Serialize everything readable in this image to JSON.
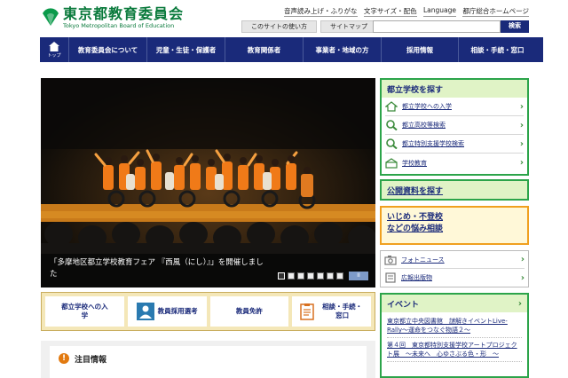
{
  "header": {
    "logo_ja": "東京都教育委員会",
    "logo_en": "Tokyo Metropolitan Board of Education",
    "top_links": [
      "音声読み上げ・ふりがな",
      "文字サイズ・配色",
      "Language",
      "都庁総合ホームページ"
    ],
    "site_usage": "このサイトの使い方",
    "sitemap": "サイトマップ",
    "search_placeholder": "",
    "search_button": "検索"
  },
  "nav": {
    "home_label": "トップ",
    "items": [
      "教育委員会について",
      "児童・生徒・保護者",
      "教育関係者",
      "事業者・地域の方",
      "採用情報",
      "相談・手続・窓口"
    ]
  },
  "hero": {
    "caption": "「多摩地区都立学校教育フェア 『西風（にし）』」を開催しました",
    "pause_label": "II",
    "dot_count": 7,
    "active_dot": 0
  },
  "quick_links": [
    "都立学校への入学",
    "教員採用選考",
    "教員免許",
    "相談・手続・窓口"
  ],
  "notice": {
    "title": "注目情報"
  },
  "right": {
    "school_search": {
      "title": "都立学校を探す",
      "items": [
        "都立学校への入学",
        "都立高校等検索",
        "都立特別支援学校検索",
        "学校教育"
      ]
    },
    "public_docs": "公開資料を探す",
    "bullying": [
      "いじめ・不登校",
      "などの悩み相談"
    ],
    "media": [
      "フォトニュース",
      "広報出版物"
    ],
    "events": {
      "title": "イベント",
      "items": [
        "東京都立中央図書館　謎解きイベントLive-Rally～運命をつなぐ物語２～",
        "第４回　東京都特別支援学校アートプロジェクト展　～未来へ　心ゆさぶる色・形　～"
      ]
    }
  },
  "colors": {
    "nav_bg": "#1a2a7a",
    "brand_green": "#0a7a3c",
    "panel_border": "#2ca44a",
    "accent_orange": "#f0a020"
  }
}
